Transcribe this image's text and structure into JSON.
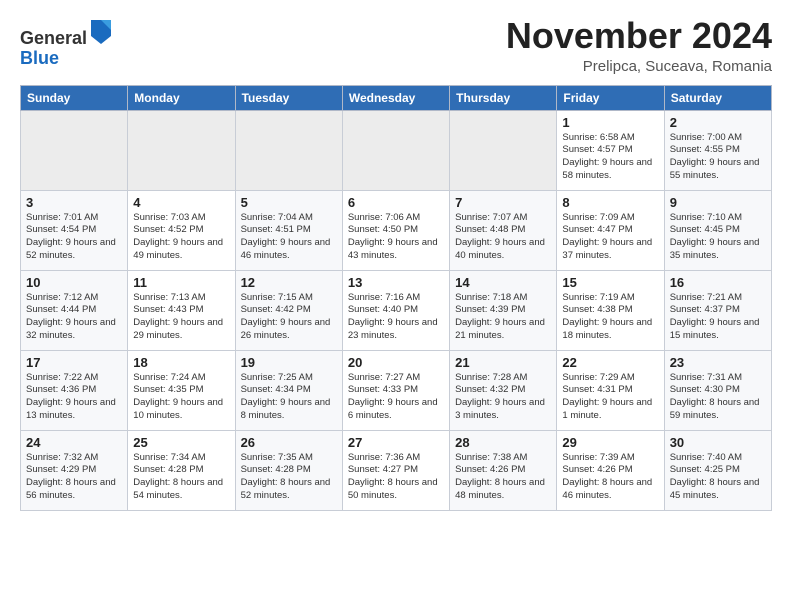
{
  "header": {
    "logo_line1": "General",
    "logo_line2": "Blue",
    "month": "November 2024",
    "location": "Prelipca, Suceava, Romania"
  },
  "weekdays": [
    "Sunday",
    "Monday",
    "Tuesday",
    "Wednesday",
    "Thursday",
    "Friday",
    "Saturday"
  ],
  "weeks": [
    [
      {
        "day": "",
        "empty": true
      },
      {
        "day": "",
        "empty": true
      },
      {
        "day": "",
        "empty": true
      },
      {
        "day": "",
        "empty": true
      },
      {
        "day": "",
        "empty": true
      },
      {
        "day": "1",
        "sunrise": "6:58 AM",
        "sunset": "4:57 PM",
        "daylight": "9 hours and 58 minutes."
      },
      {
        "day": "2",
        "sunrise": "7:00 AM",
        "sunset": "4:55 PM",
        "daylight": "9 hours and 55 minutes."
      }
    ],
    [
      {
        "day": "3",
        "sunrise": "7:01 AM",
        "sunset": "4:54 PM",
        "daylight": "9 hours and 52 minutes."
      },
      {
        "day": "4",
        "sunrise": "7:03 AM",
        "sunset": "4:52 PM",
        "daylight": "9 hours and 49 minutes."
      },
      {
        "day": "5",
        "sunrise": "7:04 AM",
        "sunset": "4:51 PM",
        "daylight": "9 hours and 46 minutes."
      },
      {
        "day": "6",
        "sunrise": "7:06 AM",
        "sunset": "4:50 PM",
        "daylight": "9 hours and 43 minutes."
      },
      {
        "day": "7",
        "sunrise": "7:07 AM",
        "sunset": "4:48 PM",
        "daylight": "9 hours and 40 minutes."
      },
      {
        "day": "8",
        "sunrise": "7:09 AM",
        "sunset": "4:47 PM",
        "daylight": "9 hours and 37 minutes."
      },
      {
        "day": "9",
        "sunrise": "7:10 AM",
        "sunset": "4:45 PM",
        "daylight": "9 hours and 35 minutes."
      }
    ],
    [
      {
        "day": "10",
        "sunrise": "7:12 AM",
        "sunset": "4:44 PM",
        "daylight": "9 hours and 32 minutes."
      },
      {
        "day": "11",
        "sunrise": "7:13 AM",
        "sunset": "4:43 PM",
        "daylight": "9 hours and 29 minutes."
      },
      {
        "day": "12",
        "sunrise": "7:15 AM",
        "sunset": "4:42 PM",
        "daylight": "9 hours and 26 minutes."
      },
      {
        "day": "13",
        "sunrise": "7:16 AM",
        "sunset": "4:40 PM",
        "daylight": "9 hours and 23 minutes."
      },
      {
        "day": "14",
        "sunrise": "7:18 AM",
        "sunset": "4:39 PM",
        "daylight": "9 hours and 21 minutes."
      },
      {
        "day": "15",
        "sunrise": "7:19 AM",
        "sunset": "4:38 PM",
        "daylight": "9 hours and 18 minutes."
      },
      {
        "day": "16",
        "sunrise": "7:21 AM",
        "sunset": "4:37 PM",
        "daylight": "9 hours and 15 minutes."
      }
    ],
    [
      {
        "day": "17",
        "sunrise": "7:22 AM",
        "sunset": "4:36 PM",
        "daylight": "9 hours and 13 minutes."
      },
      {
        "day": "18",
        "sunrise": "7:24 AM",
        "sunset": "4:35 PM",
        "daylight": "9 hours and 10 minutes."
      },
      {
        "day": "19",
        "sunrise": "7:25 AM",
        "sunset": "4:34 PM",
        "daylight": "9 hours and 8 minutes."
      },
      {
        "day": "20",
        "sunrise": "7:27 AM",
        "sunset": "4:33 PM",
        "daylight": "9 hours and 6 minutes."
      },
      {
        "day": "21",
        "sunrise": "7:28 AM",
        "sunset": "4:32 PM",
        "daylight": "9 hours and 3 minutes."
      },
      {
        "day": "22",
        "sunrise": "7:29 AM",
        "sunset": "4:31 PM",
        "daylight": "9 hours and 1 minute."
      },
      {
        "day": "23",
        "sunrise": "7:31 AM",
        "sunset": "4:30 PM",
        "daylight": "8 hours and 59 minutes."
      }
    ],
    [
      {
        "day": "24",
        "sunrise": "7:32 AM",
        "sunset": "4:29 PM",
        "daylight": "8 hours and 56 minutes."
      },
      {
        "day": "25",
        "sunrise": "7:34 AM",
        "sunset": "4:28 PM",
        "daylight": "8 hours and 54 minutes."
      },
      {
        "day": "26",
        "sunrise": "7:35 AM",
        "sunset": "4:28 PM",
        "daylight": "8 hours and 52 minutes."
      },
      {
        "day": "27",
        "sunrise": "7:36 AM",
        "sunset": "4:27 PM",
        "daylight": "8 hours and 50 minutes."
      },
      {
        "day": "28",
        "sunrise": "7:38 AM",
        "sunset": "4:26 PM",
        "daylight": "8 hours and 48 minutes."
      },
      {
        "day": "29",
        "sunrise": "7:39 AM",
        "sunset": "4:26 PM",
        "daylight": "8 hours and 46 minutes."
      },
      {
        "day": "30",
        "sunrise": "7:40 AM",
        "sunset": "4:25 PM",
        "daylight": "8 hours and 45 minutes."
      }
    ]
  ]
}
